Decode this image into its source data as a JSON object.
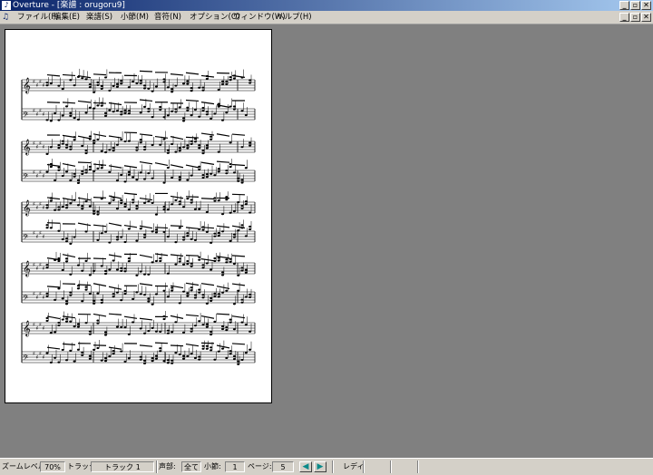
{
  "window": {
    "title": "Overture - [楽譜 : orugoru9]",
    "buttons": [
      "_",
      "▫",
      "✕"
    ]
  },
  "menu": {
    "items": [
      "ファイル(F)",
      "編集(E)",
      "楽譜(S)",
      "小節(M)",
      "音符(N)",
      "オプション(O)",
      "ウィンドウ(W)",
      "ヘルプ(H)"
    ],
    "buttons": [
      "_",
      "▫",
      "✕"
    ]
  },
  "status": {
    "zoom_label": "ズームレベル:",
    "zoom_value": "70%",
    "track_label": "トラック:",
    "track_value": "トラック 1",
    "voice_label": "声部:",
    "voice_value": "全て",
    "measure_label": "小節:",
    "measure_value": "1",
    "page_label": "ページ:",
    "page_value": "5",
    "prev_icon": "arrow-left",
    "next_icon": "arrow-right",
    "ready_text": "レディ"
  },
  "score": {
    "systems": 5,
    "staves_per_system": 2,
    "key": "four sharps (E major)"
  }
}
